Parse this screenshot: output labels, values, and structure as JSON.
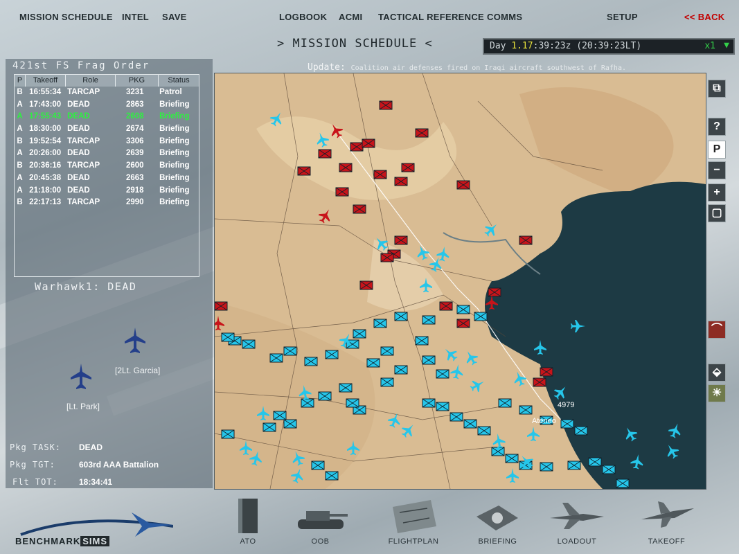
{
  "menu": {
    "left": [
      "MISSION SCHEDULE",
      "INTEL",
      "SAVE"
    ],
    "center": [
      "LOGBOOK",
      "ACMI",
      "TACTICAL REFERENCE",
      "COMMS"
    ],
    "setup": "SETUP",
    "back": "<< BACK"
  },
  "screen_title": ">  MISSION SCHEDULE  <",
  "clock": {
    "day_label": "Day",
    "day": "1",
    "hour": ".17",
    "time_rest": ":39:23z",
    "local": "(20:39:23LT)",
    "compression": "x1"
  },
  "frag": {
    "title": "421st FS Frag Order",
    "columns": [
      "P",
      "Takeoff",
      "Role",
      "PKG",
      "Status"
    ],
    "rows": [
      {
        "p": "B",
        "takeoff": "16:55:34",
        "role": "TARCAP",
        "pkg": "3231",
        "status": "Patrol"
      },
      {
        "p": "A",
        "takeoff": "17:43:00",
        "role": "DEAD",
        "pkg": "2863",
        "status": "Briefing"
      },
      {
        "p": "A",
        "takeoff": "17:55:43",
        "role": "DEAD",
        "pkg": "2608",
        "status": "Briefing"
      },
      {
        "p": "A",
        "takeoff": "18:30:00",
        "role": "DEAD",
        "pkg": "2674",
        "status": "Briefing"
      },
      {
        "p": "B",
        "takeoff": "19:52:54",
        "role": "TARCAP",
        "pkg": "3306",
        "status": "Briefing"
      },
      {
        "p": "A",
        "takeoff": "20:26:00",
        "role": "DEAD",
        "pkg": "2639",
        "status": "Briefing"
      },
      {
        "p": "B",
        "takeoff": "20:36:16",
        "role": "TARCAP",
        "pkg": "2600",
        "status": "Briefing"
      },
      {
        "p": "A",
        "takeoff": "20:45:38",
        "role": "DEAD",
        "pkg": "2663",
        "status": "Briefing"
      },
      {
        "p": "A",
        "takeoff": "21:18:00",
        "role": "DEAD",
        "pkg": "2918",
        "status": "Briefing"
      },
      {
        "p": "B",
        "takeoff": "22:17:13",
        "role": "TARCAP",
        "pkg": "2990",
        "status": "Briefing"
      }
    ]
  },
  "flight": {
    "name": "Warhawk1: DEAD",
    "pilot1": "[2Lt. Garcia]",
    "pilot2": "[Lt. Park]"
  },
  "package": {
    "task_label": "Pkg TASK:",
    "task": "DEAD",
    "tgt_label": "Pkg TGT:",
    "tgt": "603rd AAA Battalion",
    "tot_label": "Flt TOT:",
    "tot": "18:34:41"
  },
  "update": {
    "label": "Update:",
    "message": "Coalition air defenses fired on Iraqi aircraft southwest of Rafha."
  },
  "map_labels": [
    "Ateneo",
    "4979"
  ],
  "tools": [
    "?",
    "P",
    "-",
    "+"
  ],
  "bottom_nav": [
    "ATO",
    "OOB",
    "FLIGHTPLAN",
    "BRIEFING",
    "LOADOUT",
    "TAKEOFF"
  ],
  "logo": {
    "text1": "BENCHMARK",
    "text2": "SIMS"
  },
  "colors": {
    "friendly": "#26c6ea",
    "enemy": "#c8141a",
    "water": "#1d3a44",
    "land": "#d9bc93",
    "selected_row": "#2ef040",
    "back": "#c20000"
  }
}
